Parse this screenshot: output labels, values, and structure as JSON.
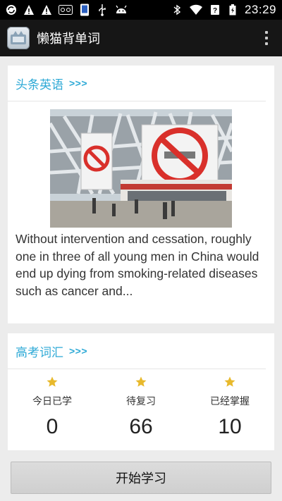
{
  "status_bar": {
    "time": "23:29",
    "left_icons": [
      "sync-icon",
      "warning-icon",
      "warning-icon",
      "voicemail-icon",
      "phone-icon",
      "usb-icon",
      "android-icon"
    ],
    "right_icons": [
      "bluetooth-icon",
      "wifi-icon",
      "signal-icon",
      "battery-icon"
    ]
  },
  "app_bar": {
    "title": "懒猫背单词"
  },
  "headline_card": {
    "title": "头条英语",
    "more": ">>>",
    "article_text": "Without intervention and cessation, roughly one in three of all young men in China would end up dying from smoking-related diseases such as cancer and..."
  },
  "vocab_card": {
    "title": "高考词汇",
    "more": ">>>",
    "stats": [
      {
        "label": "今日已学",
        "value": "0"
      },
      {
        "label": "待复习",
        "value": "66"
      },
      {
        "label": "已经掌握",
        "value": "10"
      }
    ]
  },
  "start_button": {
    "label": "开始学习"
  },
  "colors": {
    "accent": "#2da9d6",
    "star": "#e8b92c",
    "appbar": "#161616"
  }
}
